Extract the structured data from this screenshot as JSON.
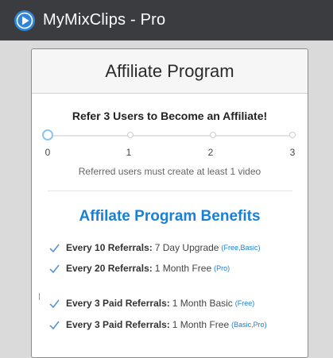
{
  "app": {
    "title": "MyMixClips - Pro",
    "logo_icon": "play-circle-icon"
  },
  "card": {
    "title": "Affiliate Program",
    "refer_heading": "Refer 3 Users to Become an Affiliate!",
    "slider": {
      "current_value": 0,
      "ticks": [
        "0",
        "1",
        "2",
        "3"
      ]
    },
    "note": "Referred users must create at least 1 video",
    "benefits_heading": "Affilate Program Benefits",
    "benefits": [
      {
        "label": "Every 10 Referrals:",
        "value": "7 Day Upgrade",
        "plans": "(Free,Basic)"
      },
      {
        "label": "Every 20 Referrals:",
        "value": "1 Month Free",
        "plans": "(Pro)"
      },
      {
        "label": "Every 3 Paid Referrals:",
        "value": "1 Month Basic",
        "plans": "(Free)"
      },
      {
        "label": "Every 3 Paid Referrals:",
        "value": "1 Month Free",
        "plans": "(Basic,Pro)"
      }
    ]
  },
  "colors": {
    "topbar": "#3a3c40",
    "accent": "#1a7fd6",
    "check": "#4a90d9"
  }
}
